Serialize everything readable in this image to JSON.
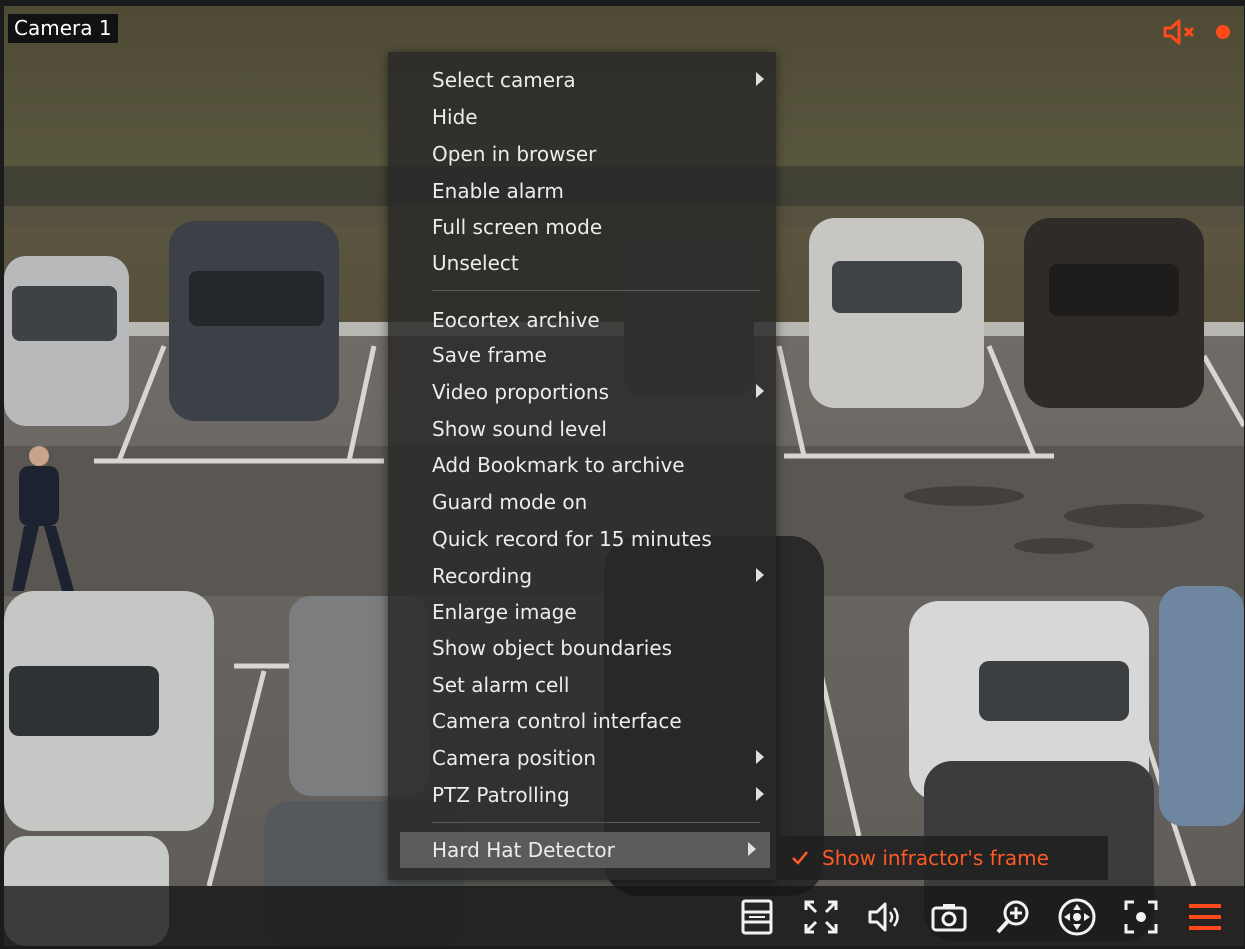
{
  "camera": {
    "title": "Camera 1"
  },
  "status": {
    "mute_icon": "speaker-muted-icon",
    "record_icon": "recording-dot-icon"
  },
  "context_menu": {
    "items": [
      {
        "label": "Select camera",
        "submenu": true
      },
      {
        "label": "Hide",
        "submenu": false
      },
      {
        "label": "Open in browser",
        "submenu": false
      },
      {
        "label": "Enable alarm",
        "submenu": false
      },
      {
        "label": "Full screen mode",
        "submenu": false
      },
      {
        "label": "Unselect",
        "submenu": false
      },
      {
        "label": "Eocortex archive",
        "submenu": false
      },
      {
        "label": "Save frame",
        "submenu": false
      },
      {
        "label": "Video proportions",
        "submenu": true
      },
      {
        "label": "Show sound level",
        "submenu": false
      },
      {
        "label": "Add Bookmark to archive",
        "submenu": false
      },
      {
        "label": "Guard mode on",
        "submenu": false
      },
      {
        "label": "Quick record for 15 minutes",
        "submenu": false
      },
      {
        "label": "Recording",
        "submenu": true
      },
      {
        "label": "Enlarge image",
        "submenu": false
      },
      {
        "label": "Show object boundaries",
        "submenu": false
      },
      {
        "label": "Set alarm cell",
        "submenu": false
      },
      {
        "label": "Camera control interface",
        "submenu": false
      },
      {
        "label": "Camera position",
        "submenu": true
      },
      {
        "label": "PTZ Patrolling",
        "submenu": true
      },
      {
        "label": "Hard Hat Detector",
        "submenu": true,
        "active": true
      }
    ]
  },
  "submenu": {
    "label": "Show infractor's frame",
    "checked": true
  },
  "toolbar": {
    "icons": [
      "layout-icon",
      "fullscreen-icon",
      "sound-icon",
      "snapshot-icon",
      "zoom-in-icon",
      "ptz-icon",
      "focus-icon",
      "menu-icon"
    ]
  },
  "colors": {
    "accent": "#ff4a1c",
    "menu_bg": "#282828",
    "active_item": "#5b5b5b"
  }
}
